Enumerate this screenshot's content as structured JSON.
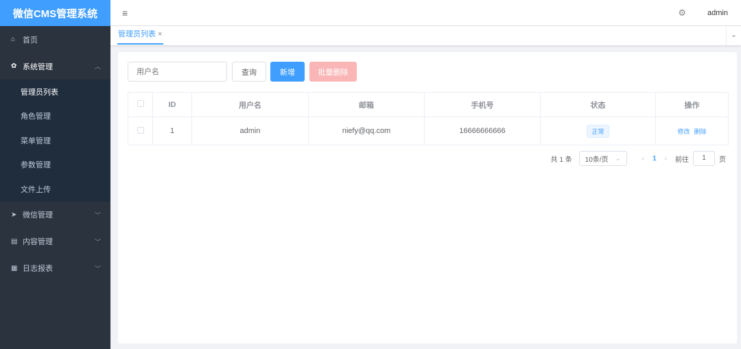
{
  "app": {
    "title": "微信CMS管理系统",
    "user": "admin"
  },
  "sidebar": {
    "items": [
      {
        "label": "首页",
        "icon": "home-icon",
        "glyph": "⌂"
      },
      {
        "label": "系统管理",
        "icon": "gear-icon",
        "glyph": "✿",
        "arrow": "︿"
      },
      {
        "label": "微信管理",
        "icon": "send-icon",
        "glyph": "➤",
        "arrow": "﹀"
      },
      {
        "label": "内容管理",
        "icon": "document-icon",
        "glyph": "▤",
        "arrow": "﹀"
      },
      {
        "label": "日志报表",
        "icon": "report-icon",
        "glyph": "▦",
        "arrow": "﹀"
      }
    ],
    "sub": [
      "管理员列表",
      "角色管理",
      "菜单管理",
      "参数管理",
      "文件上传"
    ]
  },
  "tabs": [
    {
      "label": "管理员列表",
      "close": "×"
    }
  ],
  "toolbar": {
    "search_placeholder": "用户名",
    "query": "查询",
    "add": "新增",
    "batch_delete": "批量删除"
  },
  "table": {
    "headers": [
      "ID",
      "用户名",
      "邮箱",
      "手机号",
      "状态",
      "操作"
    ],
    "rows": [
      {
        "id": "1",
        "username": "admin",
        "email": "niefy@qq.com",
        "phone": "16666666666",
        "status": "正常",
        "edit": "修改",
        "delete": "删除"
      }
    ]
  },
  "pagination": {
    "total": "共 1 条",
    "page_size": "10条/页",
    "current": "1",
    "goto_label": "前往",
    "goto_value": "1",
    "page_unit": "页"
  }
}
